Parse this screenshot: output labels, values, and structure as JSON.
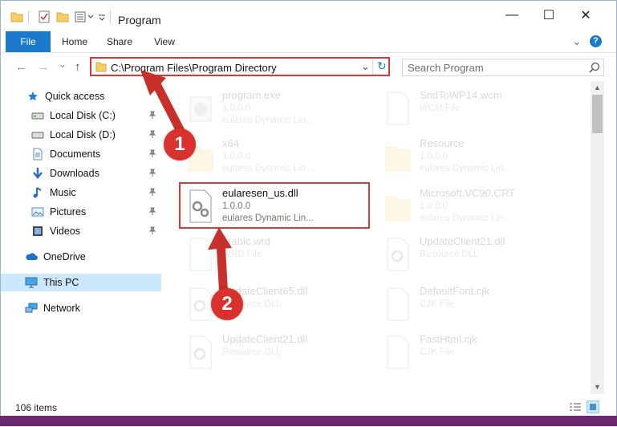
{
  "window": {
    "title": "Program",
    "controls": {
      "minimize": "—",
      "maximize": "☐",
      "close": "✕"
    }
  },
  "ribbon": {
    "tabs": [
      "File",
      "Home",
      "Share",
      "View"
    ],
    "expand_glyph": "⌄",
    "help_glyph": "?"
  },
  "address": {
    "path": "C:\\Program Files\\Program Directory",
    "dropdown_glyph": "⌄",
    "refresh_glyph": "↻"
  },
  "search": {
    "placeholder": "Search Program"
  },
  "nav": {
    "back": "←",
    "forward": "→",
    "recent": "⌄",
    "up": "↑",
    "items": [
      {
        "label": "Quick access",
        "icon": "star-icon",
        "pinned": false
      },
      {
        "label": "Local Disk (C:)",
        "icon": "drive-icon",
        "pinned": true
      },
      {
        "label": "Local Disk (D:)",
        "icon": "drive-icon",
        "pinned": true
      },
      {
        "label": "Documents",
        "icon": "documents-icon",
        "pinned": true
      },
      {
        "label": "Downloads",
        "icon": "download-icon",
        "pinned": true
      },
      {
        "label": "Music",
        "icon": "music-icon",
        "pinned": true
      },
      {
        "label": "Pictures",
        "icon": "pictures-icon",
        "pinned": true
      },
      {
        "label": "Videos",
        "icon": "videos-icon",
        "pinned": true
      },
      {
        "label": "OneDrive",
        "icon": "cloud-icon",
        "pinned": false
      },
      {
        "label": "This PC",
        "icon": "pc-icon",
        "pinned": false
      },
      {
        "label": "Network",
        "icon": "network-icon",
        "pinned": false
      }
    ],
    "pin_glyph": "📌"
  },
  "files": [
    {
      "name": "program.exe",
      "line2": "1.0.0.0",
      "line3": "eulares Dynamic Lin...",
      "icon": "exe-icon"
    },
    {
      "name": "SndToWP14.wcm",
      "line2": "WCM File",
      "line3": "",
      "icon": "file-icon"
    },
    {
      "name": "x64",
      "line2": "1.0.0.0",
      "line3": "eulares Dynamic Lin...",
      "icon": "folder-icon"
    },
    {
      "name": "Resource",
      "line2": "1.0.0.0",
      "line3": "eulares Dynamic Lin...",
      "icon": "folder-icon"
    },
    {
      "name": "eularesen_us.dll",
      "line2": "1.0.0.0",
      "line3": "eulares Dynamic Lin...",
      "icon": "dll-icon"
    },
    {
      "name": "Microsoft.VC90.CRT",
      "line2": "1.0.0.0",
      "line3": "eulares Dynamic Lin...",
      "icon": "folder-icon"
    },
    {
      "name": "arabic.wrd",
      "line2": "WRD File",
      "line3": "",
      "icon": "file-icon"
    },
    {
      "name": "UpdateClient21.dll",
      "line2": "Resource DLL",
      "line3": "",
      "icon": "dll-icon"
    },
    {
      "name": "UpdateClient65.dll",
      "line2": "Resource DLL",
      "line3": "",
      "icon": "dll-icon"
    },
    {
      "name": "DefaultFont.cjk",
      "line2": "CJK File",
      "line3": "",
      "icon": "file-icon"
    },
    {
      "name": "UpdateClient21.dll",
      "line2": "Resource DLL",
      "line3": "",
      "icon": "dll-icon"
    },
    {
      "name": "FastHtml.cjk",
      "line2": "CJK File",
      "line3": "",
      "icon": "file-icon"
    }
  ],
  "status": {
    "item_count": "106 items"
  },
  "callouts": [
    "1",
    "2"
  ],
  "colors": {
    "accent": "#1979ca",
    "highlight": "#d73a3a",
    "selected": "#cce8ff"
  }
}
